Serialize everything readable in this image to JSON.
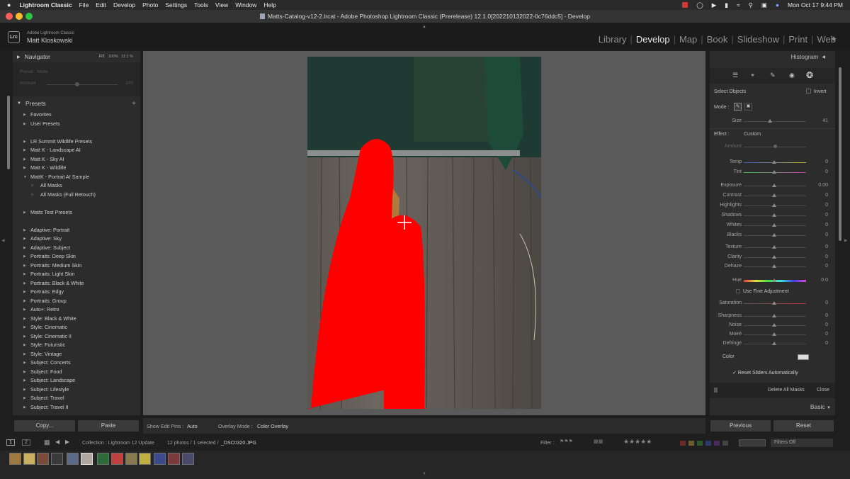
{
  "menubar": {
    "apple": "",
    "app_name": "Lightroom Classic",
    "items": [
      "File",
      "Edit",
      "Develop",
      "Photo",
      "Settings",
      "Tools",
      "View",
      "Window",
      "Help"
    ],
    "clock": "Mon Oct 17  9:44 PM"
  },
  "window": {
    "title": "Matts-Catalog-v12-2.lrcat - Adobe Photoshop Lightroom Classic (Prerelease) 12.1.0[202210132022-0c76ddc5] - Develop"
  },
  "identity": {
    "logo": "Lrc",
    "product": "Adobe Lightroom Classic",
    "user": "Matt Kloskowski"
  },
  "modules": [
    "Library",
    "Develop",
    "Map",
    "Book",
    "Slideshow",
    "Print",
    "Web"
  ],
  "active_module": "Develop",
  "left_panel": {
    "navigator": {
      "title": "Navigator",
      "zoom_fit": "FIT",
      "zoom_100": "100%",
      "zoom_ratio": "11:1 %"
    },
    "presets_title": "Presets",
    "preset_amount_label": "Preset : None",
    "amount_label": "Amount",
    "amount_value": "100",
    "groups": [
      {
        "label": "Favorites",
        "expanded": false
      },
      {
        "label": "User Presets",
        "expanded": false
      },
      {
        "label": "LR Summit Wildlife Presets",
        "expanded": false
      },
      {
        "label": "Matt K - Landscape AI",
        "expanded": false
      },
      {
        "label": "Matt K - Sky AI",
        "expanded": false
      },
      {
        "label": "Matt K - Wildlife",
        "expanded": false
      },
      {
        "label": "MattK - Portrait AI Sample",
        "expanded": true
      },
      {
        "label": "All Masks",
        "child": true
      },
      {
        "label": "All Masks (Full Retouch)",
        "child": true
      },
      {
        "label": "Matts Test Presets",
        "expanded": false
      },
      {
        "label": "Adaptive: Portrait",
        "expanded": false
      },
      {
        "label": "Adaptive: Sky",
        "expanded": false
      },
      {
        "label": "Adaptive: Subject",
        "expanded": false
      },
      {
        "label": "Portraits: Deep Skin",
        "expanded": false
      },
      {
        "label": "Portraits: Medium Skin",
        "expanded": false
      },
      {
        "label": "Portraits: Light Skin",
        "expanded": false
      },
      {
        "label": "Portraits: Black & White",
        "expanded": false
      },
      {
        "label": "Portraits: Edgy",
        "expanded": false
      },
      {
        "label": "Portraits: Group",
        "expanded": false
      },
      {
        "label": "Auto+: Retro",
        "expanded": false
      },
      {
        "label": "Style: Black & White",
        "expanded": false
      },
      {
        "label": "Style: Cinematic",
        "expanded": false
      },
      {
        "label": "Style: Cinematic II",
        "expanded": false
      },
      {
        "label": "Style: Futuristic",
        "expanded": false
      },
      {
        "label": "Style: Vintage",
        "expanded": false
      },
      {
        "label": "Subject: Concerts",
        "expanded": false
      },
      {
        "label": "Subject: Food",
        "expanded": false
      },
      {
        "label": "Subject: Landscape",
        "expanded": false
      },
      {
        "label": "Subject: Lifestyle",
        "expanded": false
      },
      {
        "label": "Subject: Travel",
        "expanded": false
      },
      {
        "label": "Subject: Travel II",
        "expanded": false
      }
    ],
    "copy_button": "Copy...",
    "paste_button": "Paste"
  },
  "toolbar": {
    "show_edit_pins_label": "Show Edit Pins :",
    "show_edit_pins_value": "Auto",
    "overlay_mode_label": "Overlay Mode :",
    "overlay_mode_value": "Color Overlay"
  },
  "right_panel": {
    "histogram_title": "Histogram",
    "select_objects": "Select Objects",
    "invert": "Invert",
    "mode_label": "Mode :",
    "size_label": "Size",
    "size_value": "41",
    "effect_label": "Effect :",
    "effect_value": "Custom",
    "amount_label": "Amount",
    "sliders": [
      {
        "label": "Temp",
        "value": "0"
      },
      {
        "label": "Tint",
        "value": "0"
      },
      {
        "label": "Exposure",
        "value": "0.00"
      },
      {
        "label": "Contrast",
        "value": "0"
      },
      {
        "label": "Highlights",
        "value": "0"
      },
      {
        "label": "Shadows",
        "value": "0"
      },
      {
        "label": "Whites",
        "value": "0"
      },
      {
        "label": "Blacks",
        "value": "0"
      },
      {
        "label": "Texture",
        "value": "0"
      },
      {
        "label": "Clarity",
        "value": "0"
      },
      {
        "label": "Dehaze",
        "value": "0"
      },
      {
        "label": "Hue",
        "value": "0.0"
      },
      {
        "label": "Saturation",
        "value": "0"
      },
      {
        "label": "Sharpness",
        "value": "0"
      },
      {
        "label": "Noise",
        "value": "0"
      },
      {
        "label": "Moiré",
        "value": "0"
      },
      {
        "label": "Defringe",
        "value": "0"
      }
    ],
    "use_fine_adjustment": "Use Fine Adjustment",
    "color_label": "Color",
    "reset_sliders": "Reset Sliders Automatically",
    "delete_all_masks": "Delete All Masks",
    "close": "Close",
    "basic_title": "Basic",
    "previous_button": "Previous",
    "reset_button": "Reset"
  },
  "filmstrip": {
    "screen1": "1",
    "screen2": "2",
    "collection": "Collection : Lightroom 12 Update",
    "count": "12 photos / 1 selected /",
    "filename": "_DSC0320.JPG",
    "filter_label": "Filter :",
    "filters_off": "Filters Off"
  },
  "colors": {
    "mask_overlay": "#ff0000",
    "panel_bg": "#2c2c2c",
    "canvas_bg": "#5a5a5a"
  }
}
